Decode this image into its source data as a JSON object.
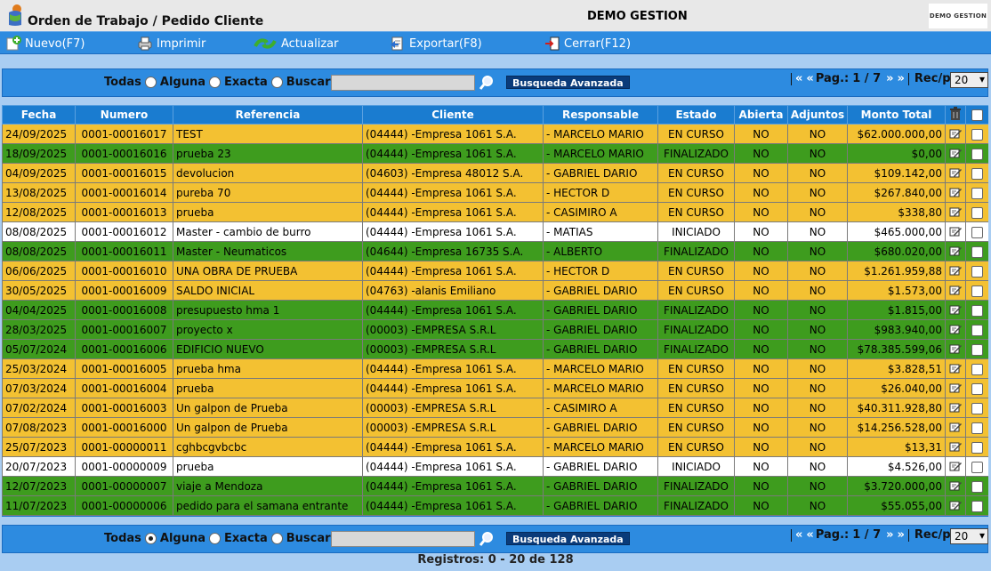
{
  "header": {
    "title": "Orden de Trabajo / Pedido Cliente",
    "company": "DEMO GESTION",
    "brand": "DEMO GESTION"
  },
  "toolbar": {
    "nuevo": "Nuevo(F7)",
    "imprimir": "Imprimir",
    "actualizar": "Actualizar",
    "exportar": "Exportar(F8)",
    "cerrar": "Cerrar(F12)"
  },
  "search_top": {
    "todas": "Todas",
    "alguna": "Alguna",
    "exacta": "Exacta",
    "buscar": "Buscar",
    "selected": "none",
    "query": "",
    "advanced": "Busqueda Avanzada",
    "pag_label": "Pag.:",
    "pag_value": "1 / 7",
    "rec_label": "Rec/pg:",
    "rec_value": "20"
  },
  "search_bottom": {
    "todas": "Todas",
    "alguna": "Alguna",
    "exacta": "Exacta",
    "buscar": "Buscar",
    "selected": "alguna",
    "query": "",
    "advanced": "Busqueda Avanzada",
    "pag_label": "Pag.:",
    "pag_value": "1 / 7",
    "rec_label": "Rec/pg:",
    "rec_value": "20"
  },
  "columns": [
    "Fecha",
    "Numero",
    "Referencia",
    "Cliente",
    "Responsable",
    "Estado",
    "Abierta",
    "Adjuntos",
    "Monto Total"
  ],
  "rows": [
    {
      "fecha": "24/09/2025",
      "numero": "0001-00016017",
      "ref": "TEST",
      "cliente": "(04444) -Empresa 1061 S.A.",
      "resp": "- MARCELO MARIO",
      "estado": "EN CURSO",
      "abierta": "NO",
      "adjuntos": "NO",
      "monto": "$62.000.000,00",
      "status": "curso"
    },
    {
      "fecha": "18/09/2025",
      "numero": "0001-00016016",
      "ref": "prueba 23",
      "cliente": "(04444) -Empresa 1061 S.A.",
      "resp": "- MARCELO MARIO",
      "estado": "FINALIZADO",
      "abierta": "NO",
      "adjuntos": "NO",
      "monto": "$0,00",
      "status": "fin"
    },
    {
      "fecha": "04/09/2025",
      "numero": "0001-00016015",
      "ref": "devolucion",
      "cliente": "(04603) -Empresa 48012 S.A.",
      "resp": "- GABRIEL DARIO",
      "estado": "EN CURSO",
      "abierta": "NO",
      "adjuntos": "NO",
      "monto": "$109.142,00",
      "status": "curso"
    },
    {
      "fecha": "13/08/2025",
      "numero": "0001-00016014",
      "ref": "pureba 70",
      "cliente": "(04444) -Empresa 1061 S.A.",
      "resp": "- HECTOR D",
      "estado": "EN CURSO",
      "abierta": "NO",
      "adjuntos": "NO",
      "monto": "$267.840,00",
      "status": "curso"
    },
    {
      "fecha": "12/08/2025",
      "numero": "0001-00016013",
      "ref": "prueba",
      "cliente": "(04444) -Empresa 1061 S.A.",
      "resp": "- CASIMIRO A",
      "estado": "EN CURSO",
      "abierta": "NO",
      "adjuntos": "NO",
      "monto": "$338,80",
      "status": "curso"
    },
    {
      "fecha": "08/08/2025",
      "numero": "0001-00016012",
      "ref": "Master - cambio de burro",
      "cliente": "(04444) -Empresa 1061 S.A.",
      "resp": "- MATIAS",
      "estado": "INICIADO",
      "abierta": "NO",
      "adjuntos": "NO",
      "monto": "$465.000,00",
      "status": "ini"
    },
    {
      "fecha": "08/08/2025",
      "numero": "0001-00016011",
      "ref": "Master - Neumaticos",
      "cliente": "(04644) -Empresa 16735 S.A.",
      "resp": "- ALBERTO",
      "estado": "FINALIZADO",
      "abierta": "NO",
      "adjuntos": "NO",
      "monto": "$680.020,00",
      "status": "fin"
    },
    {
      "fecha": "06/06/2025",
      "numero": "0001-00016010",
      "ref": "UNA OBRA DE PRUEBA",
      "cliente": "(04444) -Empresa 1061 S.A.",
      "resp": "- HECTOR D",
      "estado": "EN CURSO",
      "abierta": "NO",
      "adjuntos": "NO",
      "monto": "$1.261.959,88",
      "status": "curso"
    },
    {
      "fecha": "30/05/2025",
      "numero": "0001-00016009",
      "ref": "SALDO INICIAL",
      "cliente": "(04763) -alanis Emiliano",
      "resp": "- GABRIEL DARIO",
      "estado": "EN CURSO",
      "abierta": "NO",
      "adjuntos": "NO",
      "monto": "$1.573,00",
      "status": "curso"
    },
    {
      "fecha": "04/04/2025",
      "numero": "0001-00016008",
      "ref": "presupuesto hma 1",
      "cliente": "(04444) -Empresa 1061 S.A.",
      "resp": "- GABRIEL DARIO",
      "estado": "FINALIZADO",
      "abierta": "NO",
      "adjuntos": "NO",
      "monto": "$1.815,00",
      "status": "fin"
    },
    {
      "fecha": "28/03/2025",
      "numero": "0001-00016007",
      "ref": "proyecto x",
      "cliente": "(00003) -EMPRESA S.R.L",
      "resp": "- GABRIEL DARIO",
      "estado": "FINALIZADO",
      "abierta": "NO",
      "adjuntos": "NO",
      "monto": "$983.940,00",
      "status": "fin"
    },
    {
      "fecha": "05/07/2024",
      "numero": "0001-00016006",
      "ref": "EDIFICIO NUEVO",
      "cliente": "(00003) -EMPRESA S.R.L",
      "resp": "- GABRIEL DARIO",
      "estado": "FINALIZADO",
      "abierta": "NO",
      "adjuntos": "NO",
      "monto": "$78.385.599,06",
      "status": "fin"
    },
    {
      "fecha": "25/03/2024",
      "numero": "0001-00016005",
      "ref": "prueba hma",
      "cliente": "(04444) -Empresa 1061 S.A.",
      "resp": "- MARCELO MARIO",
      "estado": "EN CURSO",
      "abierta": "NO",
      "adjuntos": "NO",
      "monto": "$3.828,51",
      "status": "curso"
    },
    {
      "fecha": "07/03/2024",
      "numero": "0001-00016004",
      "ref": "prueba",
      "cliente": "(04444) -Empresa 1061 S.A.",
      "resp": "- MARCELO MARIO",
      "estado": "EN CURSO",
      "abierta": "NO",
      "adjuntos": "NO",
      "monto": "$26.040,00",
      "status": "curso"
    },
    {
      "fecha": "07/02/2024",
      "numero": "0001-00016003",
      "ref": "Un galpon de Prueba",
      "cliente": "(00003) -EMPRESA S.R.L",
      "resp": "- CASIMIRO A",
      "estado": "EN CURSO",
      "abierta": "NO",
      "adjuntos": "NO",
      "monto": "$40.311.928,80",
      "status": "curso"
    },
    {
      "fecha": "07/08/2023",
      "numero": "0001-00016000",
      "ref": "Un galpon de Prueba",
      "cliente": "(00003) -EMPRESA S.R.L",
      "resp": "- GABRIEL DARIO",
      "estado": "EN CURSO",
      "abierta": "NO",
      "adjuntos": "NO",
      "monto": "$14.256.528,00",
      "status": "curso"
    },
    {
      "fecha": "25/07/2023",
      "numero": "0001-00000011",
      "ref": "cghbcgvbcbc",
      "cliente": "(04444) -Empresa 1061 S.A.",
      "resp": "- MARCELO MARIO",
      "estado": "EN CURSO",
      "abierta": "NO",
      "adjuntos": "NO",
      "monto": "$13,31",
      "status": "curso"
    },
    {
      "fecha": "20/07/2023",
      "numero": "0001-00000009",
      "ref": "prueba",
      "cliente": "(04444) -Empresa 1061 S.A.",
      "resp": "- GABRIEL DARIO",
      "estado": "INICIADO",
      "abierta": "NO",
      "adjuntos": "NO",
      "monto": "$4.526,00",
      "status": "ini"
    },
    {
      "fecha": "12/07/2023",
      "numero": "0001-00000007",
      "ref": "viaje a Mendoza",
      "cliente": "(04444) -Empresa 1061 S.A.",
      "resp": "- GABRIEL DARIO",
      "estado": "FINALIZADO",
      "abierta": "NO",
      "adjuntos": "NO",
      "monto": "$3.720.000,00",
      "status": "fin"
    },
    {
      "fecha": "11/07/2023",
      "numero": "0001-00000006",
      "ref": "pedido para el samana entrante",
      "cliente": "(04444) -Empresa 1061 S.A.",
      "resp": "- GABRIEL DARIO",
      "estado": "FINALIZADO",
      "abierta": "NO",
      "adjuntos": "NO",
      "monto": "$55.055,00",
      "status": "fin"
    }
  ],
  "footer": {
    "records": "Registros: 0 - 20 de 128"
  },
  "colors": {
    "toolbar": "#2d8be0",
    "curso": "#f3c132",
    "finalizado": "#3e9c1e",
    "iniciado": "#ffffff",
    "header": "#1a7cd0"
  }
}
